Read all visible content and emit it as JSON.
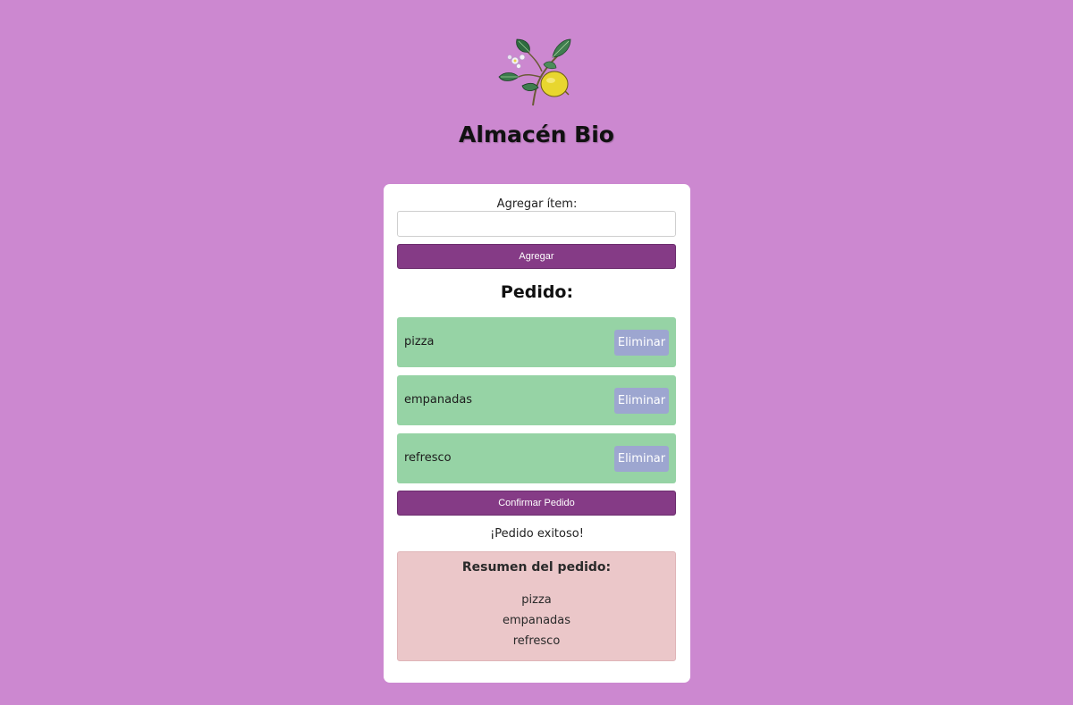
{
  "app": {
    "title": "Almacén Bio",
    "logo_icon": "lemon-branch-illustration"
  },
  "form": {
    "label": "Agregar ítem:",
    "input_value": "",
    "input_placeholder": "",
    "add_button_label": "Agregar"
  },
  "order": {
    "title": "Pedido:",
    "items": [
      {
        "name": "pizza",
        "remove_label": "Eliminar"
      },
      {
        "name": "empanadas",
        "remove_label": "Eliminar"
      },
      {
        "name": "refresco",
        "remove_label": "Eliminar"
      }
    ],
    "confirm_button_label": "Confirmar Pedido",
    "success_message": "¡Pedido exitoso!"
  },
  "summary": {
    "title": "Resumen del pedido:",
    "items": [
      "pizza",
      "empanadas",
      "refresco"
    ]
  },
  "colors": {
    "background": "#cc88d0",
    "primary_button": "#853b86",
    "order_item": "#96d3a5",
    "remove_button": "#9da6d0",
    "summary_box": "#ebc7c9"
  }
}
